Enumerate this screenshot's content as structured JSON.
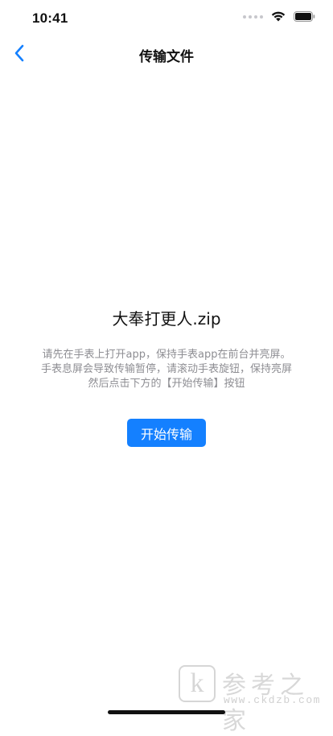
{
  "status_bar": {
    "time": "10:41"
  },
  "nav": {
    "back_icon": "chevron-left-icon",
    "title": "传输文件"
  },
  "content": {
    "file_name": "大奉打更人.zip",
    "instruction_lines": [
      "请先在手表上打开app，保持手表app在前台并亮屏。",
      "手表息屏会导致传输暂停，请滚动手表旋钮，保持亮屏",
      "然后点击下方的【开始传输】按钮"
    ],
    "start_button_label": "开始传输"
  },
  "watermark": {
    "logo_letter": "k",
    "title": "参考之家",
    "url": "www.ckdzb.com"
  },
  "colors": {
    "accent": "#1480ff",
    "muted_text": "#8e8e93"
  }
}
